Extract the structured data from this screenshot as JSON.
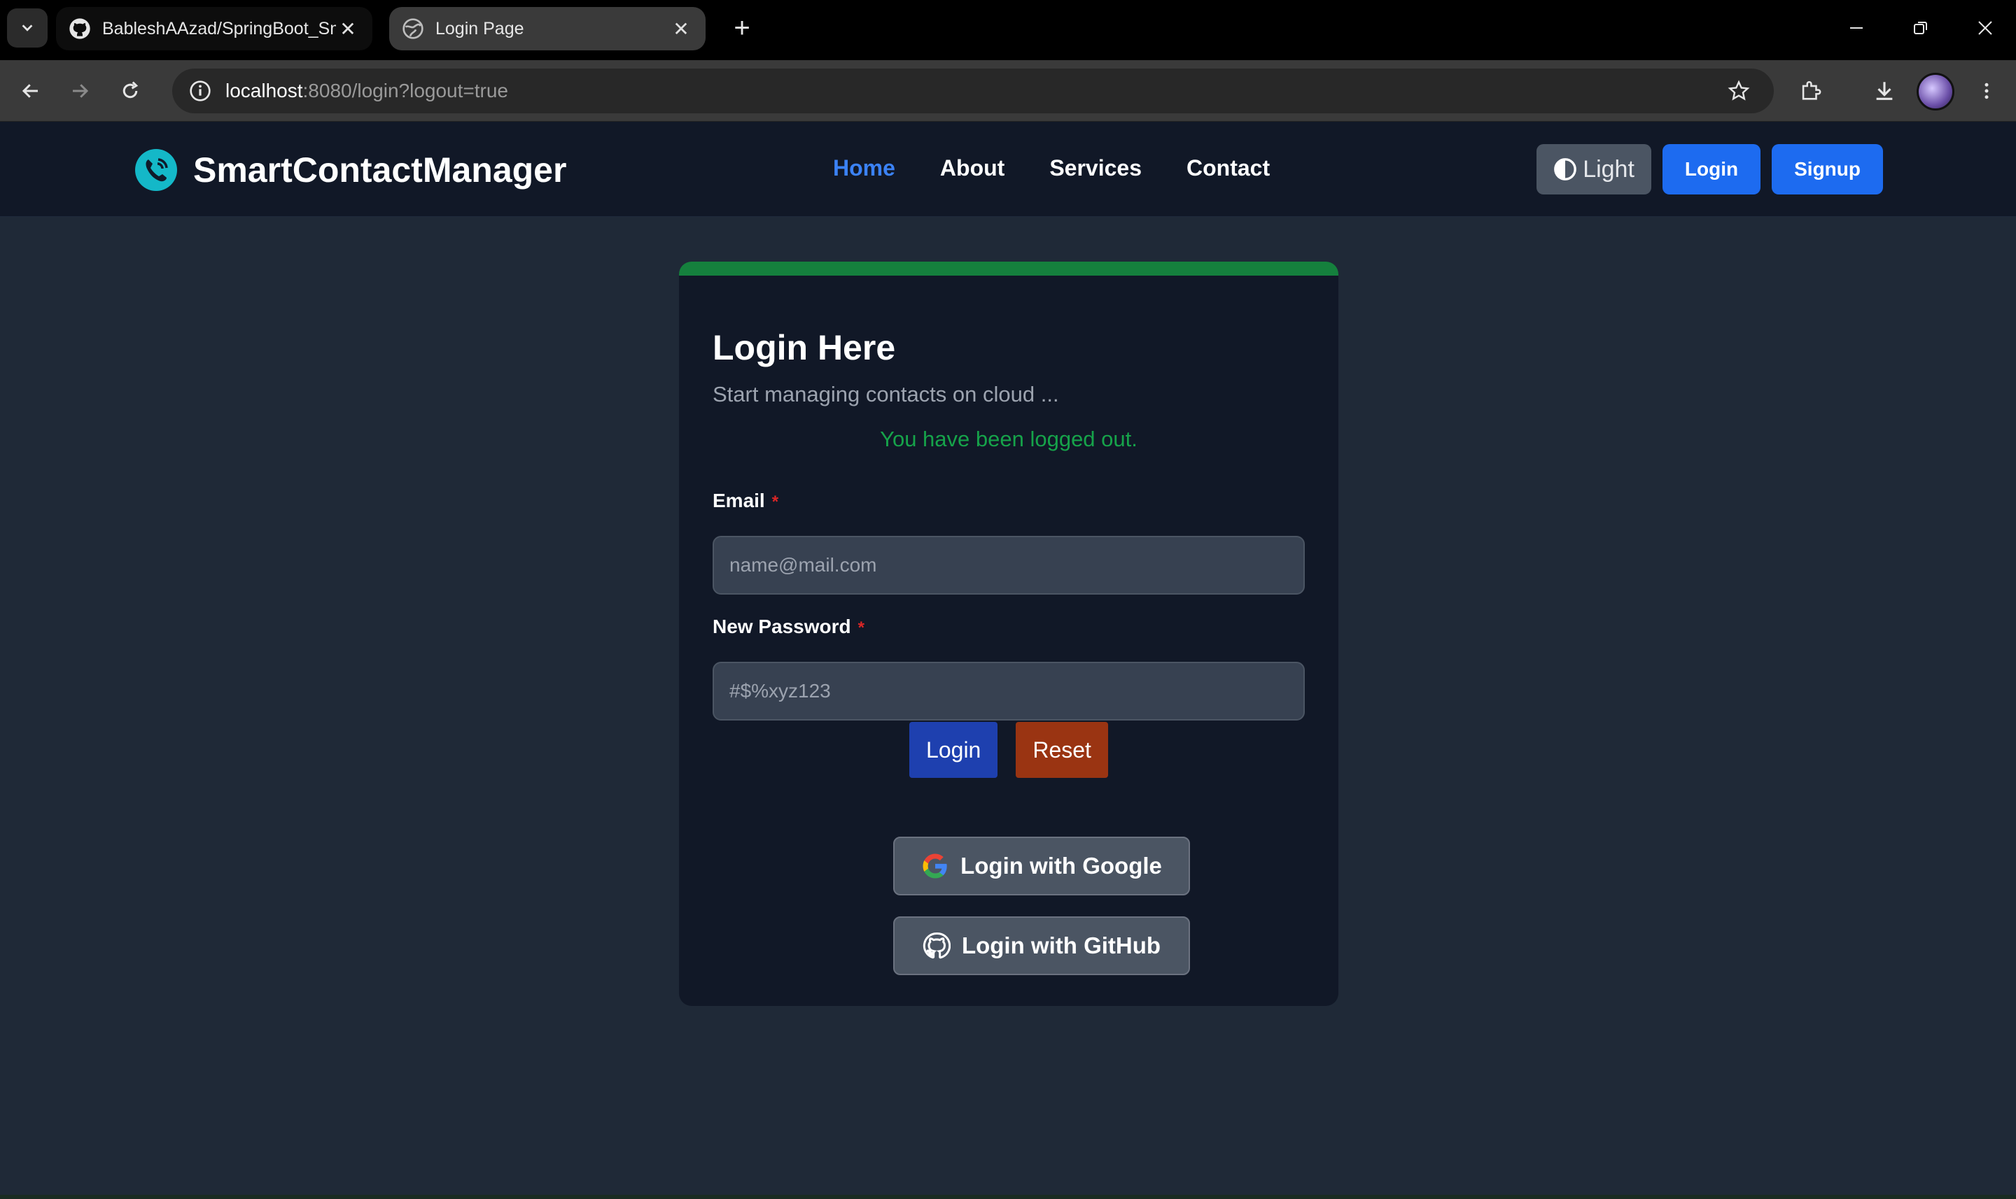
{
  "browser": {
    "tabs": [
      {
        "title": "BableshAAzad/SpringBoot_Sma",
        "active": false,
        "icon": "github-icon"
      },
      {
        "title": "Login Page",
        "active": true,
        "icon": "globe-icon"
      }
    ],
    "url_host": "localhost",
    "url_rest": ":8080/login?logout=true"
  },
  "navbar": {
    "brand": "SmartContactManager",
    "links": [
      {
        "label": "Home",
        "active": true
      },
      {
        "label": "About",
        "active": false
      },
      {
        "label": "Services",
        "active": false
      },
      {
        "label": "Contact",
        "active": false
      }
    ],
    "theme_label": "Light",
    "login_label": "Login",
    "signup_label": "Signup"
  },
  "login": {
    "title": "Login Here",
    "subtitle": "Start managing contacts on cloud ...",
    "message": "You have been logged out.",
    "email_label": "Email",
    "email_placeholder": "name@mail.com",
    "password_label": "New Password",
    "password_placeholder": "#$%xyz123",
    "required_mark": "*",
    "login_button": "Login",
    "reset_button": "Reset",
    "google_button": "Login with Google",
    "github_button": "Login with GitHub"
  },
  "colors": {
    "accent_blue": "#1d6bf0",
    "active_link": "#3b82f6",
    "success_green": "#16a34a",
    "card_top_border": "#15803d",
    "reset_orange": "#9a3412"
  }
}
